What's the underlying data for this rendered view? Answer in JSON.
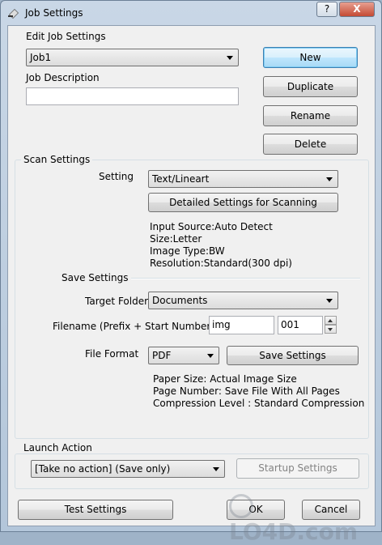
{
  "window": {
    "title": "Job Settings",
    "help_label": "?",
    "close_label": "X"
  },
  "job": {
    "edit_label": "Edit Job Settings",
    "selected_job": "Job1",
    "description_label": "Job Description",
    "description_value": "",
    "buttons": {
      "new": "New",
      "duplicate": "Duplicate",
      "rename": "Rename",
      "delete": "Delete"
    }
  },
  "scan": {
    "group_label": "Scan Settings",
    "setting_label": "Setting",
    "setting_value": "Text/Lineart",
    "detailed_button": "Detailed Settings for Scanning",
    "info": [
      "Input Source:Auto Detect",
      "Size:Letter",
      "Image Type:BW",
      "Resolution:Standard(300 dpi)"
    ]
  },
  "save": {
    "section_label": "Save Settings",
    "target_folder_label": "Target Folder",
    "target_folder_value": "Documents",
    "filename_label": "Filename (Prefix + Start Number)",
    "prefix_value": "img",
    "start_number_value": "001",
    "file_format_label": "File Format",
    "file_format_value": "PDF",
    "save_settings_button": "Save Settings",
    "info": [
      "Paper Size: Actual Image Size",
      "Page Number: Save File With All Pages",
      "Compression Level : Standard Compression"
    ]
  },
  "launch": {
    "group_label": "Launch Action",
    "action_value": "[Take no action] (Save only)",
    "startup_button": "Startup Settings"
  },
  "footer": {
    "test_button": "Test Settings",
    "ok_button": "OK",
    "cancel_button": "Cancel"
  },
  "watermark": {
    "text": "LO4D.com"
  },
  "colors": {
    "default_button_border": "#3c7fb1",
    "dialog_background": "#f0f0f0"
  }
}
